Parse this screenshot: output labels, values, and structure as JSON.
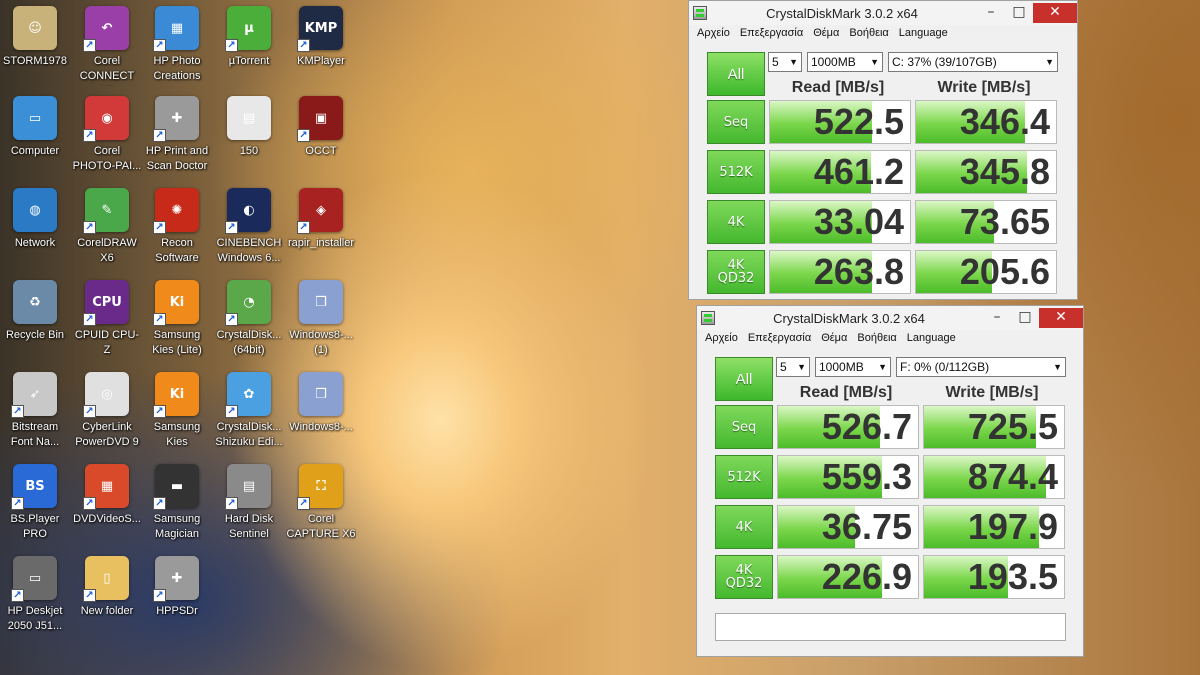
{
  "desktop": {
    "icons": [
      {
        "label": "STORM1978",
        "bg": "#c9b27a",
        "glyph": "☺"
      },
      {
        "label": "Corel CONNECT X6",
        "bg": "#9a3fa8",
        "glyph": "↶"
      },
      {
        "label": "HP Photo Creations",
        "bg": "#3a8ad6",
        "glyph": "▦"
      },
      {
        "label": "µTorrent",
        "bg": "#4cae3a",
        "glyph": "µ"
      },
      {
        "label": "KMPlayer",
        "bg": "#1f2a44",
        "glyph": "KMP"
      },
      {
        "label": "Computer",
        "bg": "#3b8fd6",
        "glyph": "▭"
      },
      {
        "label": "Corel PHOTO-PAI...",
        "bg": "#d23a3a",
        "glyph": "◉"
      },
      {
        "label": "HP Print and Scan Doctor",
        "bg": "#9a9a9a",
        "glyph": "✚"
      },
      {
        "label": "150",
        "bg": "#e8e8e8",
        "glyph": "▤"
      },
      {
        "label": "OCCT",
        "bg": "#8a1a1a",
        "glyph": "▣"
      },
      {
        "label": "Network",
        "bg": "#2a7ac6",
        "glyph": "◍"
      },
      {
        "label": "CorelDRAW X6",
        "bg": "#4aa84a",
        "glyph": "✎"
      },
      {
        "label": "Recon Software",
        "bg": "#c82a1a",
        "glyph": "✺"
      },
      {
        "label": "CINEBENCH Windows 6...",
        "bg": "#1a2a5a",
        "glyph": "◐"
      },
      {
        "label": "rapir_installer",
        "bg": "#a82222",
        "glyph": "◈"
      },
      {
        "label": "Recycle Bin",
        "bg": "#6a8aa8",
        "glyph": "♻"
      },
      {
        "label": "CPUID CPU-Z",
        "bg": "#6a2a8a",
        "glyph": "CPU"
      },
      {
        "label": "Samsung Kies (Lite)",
        "bg": "#f08a1a",
        "glyph": "Ki"
      },
      {
        "label": "CrystalDisk... (64bit)",
        "bg": "#5aa84a",
        "glyph": "◔"
      },
      {
        "label": "Windows8-... (1)",
        "bg": "#8aa0d0",
        "glyph": "❒"
      },
      {
        "label": "Bitstream Font Na...",
        "bg": "#c8c8c8",
        "glyph": "➶"
      },
      {
        "label": "CyberLink PowerDVD 9",
        "bg": "#e0e0e0",
        "glyph": "◎"
      },
      {
        "label": "Samsung Kies",
        "bg": "#f08a1a",
        "glyph": "Ki"
      },
      {
        "label": "CrystalDisk... Shizuku Edi...",
        "bg": "#4aa0e0",
        "glyph": "✿"
      },
      {
        "label": "Windows8-...",
        "bg": "#8aa0d0",
        "glyph": "❒"
      },
      {
        "label": "BS.Player PRO",
        "bg": "#2a6ad6",
        "glyph": "BS"
      },
      {
        "label": "DVDVideoS...",
        "bg": "#d84a2a",
        "glyph": "▦"
      },
      {
        "label": "Samsung Magician",
        "bg": "#333333",
        "glyph": "▬"
      },
      {
        "label": "Hard Disk Sentinel",
        "bg": "#8a8a8a",
        "glyph": "▤"
      },
      {
        "label": "Corel CAPTURE X6",
        "bg": "#e0a01a",
        "glyph": "⛶"
      },
      {
        "label": "HP Deskjet 2050 J51...",
        "bg": "#6a6a6a",
        "glyph": "▭"
      },
      {
        "label": "New folder",
        "bg": "#e8c060",
        "glyph": "▯"
      },
      {
        "label": "HPPSDr",
        "bg": "#9a9a9a",
        "glyph": "✚"
      }
    ]
  },
  "windows": [
    {
      "title": "CrystalDiskMark 3.0.2 x64",
      "menu": [
        "Αρχείο",
        "Επεξεργασία",
        "Θέμα",
        "Βοήθεια",
        "Language"
      ],
      "runs": "5",
      "size": "1000MB",
      "drive": "C: 37% (39/107GB)",
      "all_label": "All",
      "read_header": "Read [MB/s]",
      "write_header": "Write [MB/s]",
      "rows": [
        {
          "label": "Seq",
          "read": "522.5",
          "write": "346.4",
          "read_fill": 0.73,
          "write_fill": 0.78
        },
        {
          "label": "512K",
          "read": "461.2",
          "write": "345.8",
          "read_fill": 0.72,
          "write_fill": 0.79
        },
        {
          "label": "4K",
          "read": "33.04",
          "write": "73.65",
          "read_fill": 0.73,
          "write_fill": 0.56
        },
        {
          "label": "4K\nQD32",
          "read": "263.8",
          "write": "205.6",
          "read_fill": 0.73,
          "write_fill": 0.54
        }
      ]
    },
    {
      "title": "CrystalDiskMark 3.0.2 x64",
      "menu": [
        "Αρχείο",
        "Επεξεργασία",
        "Θέμα",
        "Βοήθεια",
        "Language"
      ],
      "runs": "5",
      "size": "1000MB",
      "drive": "F: 0% (0/112GB)",
      "all_label": "All",
      "read_header": "Read [MB/s]",
      "write_header": "Write [MB/s]",
      "rows": [
        {
          "label": "Seq",
          "read": "526.7",
          "write": "725.5",
          "read_fill": 0.73,
          "write_fill": 0.8
        },
        {
          "label": "512K",
          "read": "559.3",
          "write": "874.4",
          "read_fill": 0.74,
          "write_fill": 0.87
        },
        {
          "label": "4K",
          "read": "36.75",
          "write": "197.9",
          "read_fill": 0.55,
          "write_fill": 0.82
        },
        {
          "label": "4K\nQD32",
          "read": "226.9",
          "write": "193.5",
          "read_fill": 0.74,
          "write_fill": 0.6
        }
      ],
      "comment": ""
    }
  ],
  "colors": {
    "accent_green": "#4cbc2a",
    "close_red": "#c7302b"
  }
}
